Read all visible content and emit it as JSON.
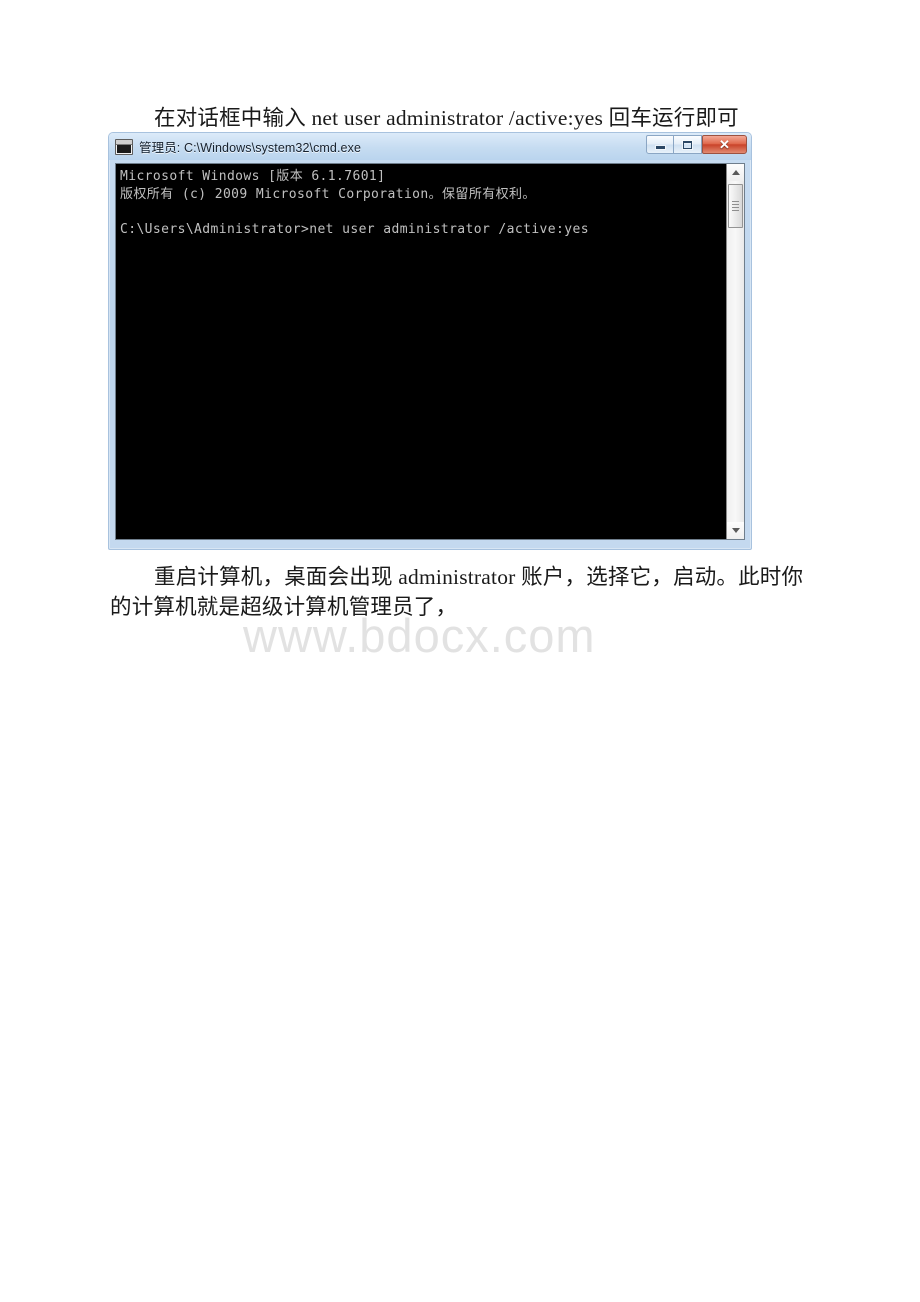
{
  "document": {
    "paragraph_top": "在对话框中输入 net user administrator /active:yes 回车运行即可",
    "paragraph_bottom": "重启计算机，桌面会出现 administrator 账户，选择它，启动。此时你的计算机就是超级计算机管理员了，",
    "watermark": "www.bdocx.com"
  },
  "cmd_window": {
    "title": "管理员: C:\\Windows\\system32\\cmd.exe",
    "title_prefix": "管理员",
    "title_path": ": C:\\Windows\\system32\\cmd.exe",
    "icon": "cmd-console-icon",
    "buttons": {
      "minimize": "—",
      "maximize": "❐",
      "close": "✕"
    },
    "console_text": "Microsoft Windows [版本 6.1.7601]\n版权所有 (c) 2009 Microsoft Corporation。保留所有权利。\n\nC:\\Users\\Administrator>net user administrator /active:yes",
    "console_lines": [
      "Microsoft Windows [版本 6.1.7601]",
      "版权所有 (c) 2009 Microsoft Corporation。保留所有权利。",
      "",
      "C:\\Users\\Administrator>net user administrator /active:yes"
    ],
    "scrollbar": {
      "up_arrow": "▲",
      "down_arrow": "▼"
    }
  },
  "colors": {
    "page_background": "#ffffff",
    "window_frame": "#c4d9ef",
    "titlebar": "#cfe1f4",
    "console_background": "#000000",
    "console_text": "#c0c0c0",
    "close_button": "#c9432a",
    "watermark": "#e2e2e2"
  }
}
